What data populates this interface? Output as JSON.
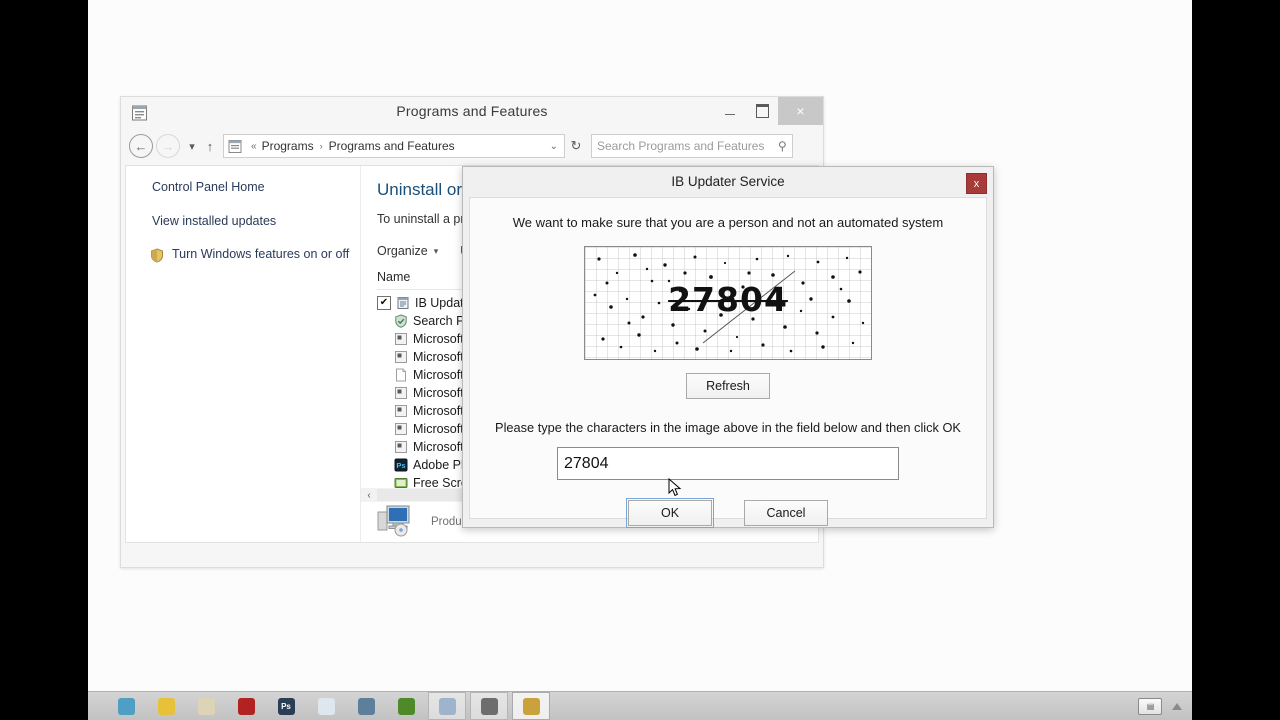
{
  "window": {
    "title": "Programs and Features",
    "title_icon": "programs-features-icon",
    "minimize_label": "Minimize",
    "maximize_label": "Restore",
    "close_label": "×",
    "nav": {
      "back": "←",
      "forward": "→",
      "history_caret": "▾",
      "up": "↑",
      "breadcrumb_prefix": "«",
      "breadcrumb": [
        "Programs",
        "Programs and Features"
      ],
      "breadcrumb_separator": "›",
      "address_dropdown": "⌄",
      "refresh": "↻"
    },
    "search": {
      "placeholder": "Search Programs and Features",
      "value": "",
      "icon": "magnifier-icon"
    }
  },
  "sidebar": {
    "items": [
      {
        "label": "Control Panel Home",
        "icon": ""
      },
      {
        "label": "View installed updates",
        "icon": ""
      },
      {
        "label": "Turn Windows features on or off",
        "icon": "shield-icon"
      }
    ]
  },
  "content": {
    "heading": "Uninstall or chang",
    "subtext": "To uninstall a program,",
    "toolbar": {
      "organize": "Organize",
      "organize_caret": "▾",
      "uninstall": "Uninstall"
    },
    "column_header": "Name",
    "rows": [
      {
        "name": "IB Updater Service",
        "checked": true,
        "icon": "installer-icon"
      },
      {
        "name": "Search Protect by con",
        "checked": false,
        "icon": "shield-icon"
      },
      {
        "name": "Microsoft Visual C++",
        "checked": false,
        "icon": "msi-icon"
      },
      {
        "name": "Microsoft Visual C++",
        "checked": false,
        "icon": "msi-icon"
      },
      {
        "name": "Microsoft Primary Int",
        "checked": false,
        "icon": "document-icon"
      },
      {
        "name": "Microsoft Visual C++",
        "checked": false,
        "icon": "msi-icon"
      },
      {
        "name": "Microsoft Visual C++",
        "checked": false,
        "icon": "msi-icon"
      },
      {
        "name": "Microsoft Visual C++",
        "checked": false,
        "icon": "msi-icon"
      },
      {
        "name": "Microsoft Visual C++",
        "checked": false,
        "icon": "msi-icon"
      },
      {
        "name": "Adobe Photoshop CC",
        "checked": false,
        "icon": "photoshop-icon"
      },
      {
        "name": "Free Screen Video Rec",
        "checked": false,
        "icon": "recorder-icon"
      }
    ],
    "scroll_left_arrow": "‹",
    "details": {
      "icon": "computer-icon",
      "text": "Product versi"
    }
  },
  "dialog": {
    "title": "IB Updater Service",
    "close_label": "x",
    "close_color": "#a83a3a",
    "lead": "We want to make sure that you are a person and not an automated system",
    "captcha": {
      "code": "27804",
      "alt": "captcha-image"
    },
    "refresh_label": "Refresh",
    "instruction": "Please type the characters in the image above in the field below and then click OK",
    "input": {
      "value": "27804",
      "placeholder": ""
    },
    "ok_label": "OK",
    "cancel_label": "Cancel"
  },
  "taskbar": {
    "items": [
      {
        "name": "browser-teal",
        "color": "#4f9ec4",
        "glyph": "",
        "state": "pinned"
      },
      {
        "name": "chrome",
        "color": "#e8c13a",
        "glyph": "",
        "state": "pinned"
      },
      {
        "name": "folder-beige",
        "color": "#ddd3b6",
        "glyph": "",
        "state": "pinned"
      },
      {
        "name": "red-app",
        "color": "#b32222",
        "glyph": "",
        "state": "pinned"
      },
      {
        "name": "photoshop",
        "color": "#2a3f56",
        "glyph": "Ps",
        "state": "pinned"
      },
      {
        "name": "notepad",
        "color": "#dfe7ee",
        "glyph": "",
        "state": "pinned"
      },
      {
        "name": "editor-blue",
        "color": "#5d7f9c",
        "glyph": "",
        "state": "pinned"
      },
      {
        "name": "green-app",
        "color": "#4e8a2a",
        "glyph": "",
        "state": "pinned"
      },
      {
        "name": "messenger",
        "color": "#9db4cc",
        "glyph": "",
        "state": "open"
      },
      {
        "name": "video-recorder",
        "color": "#6d6d6d",
        "glyph": "",
        "state": "open"
      },
      {
        "name": "programs-and-features",
        "color": "#c9a23c",
        "glyph": "",
        "state": "active"
      }
    ],
    "tray": {
      "keyboard_icon": "keyboard-icon",
      "show_hidden_icon": "show-hidden-icons"
    }
  }
}
